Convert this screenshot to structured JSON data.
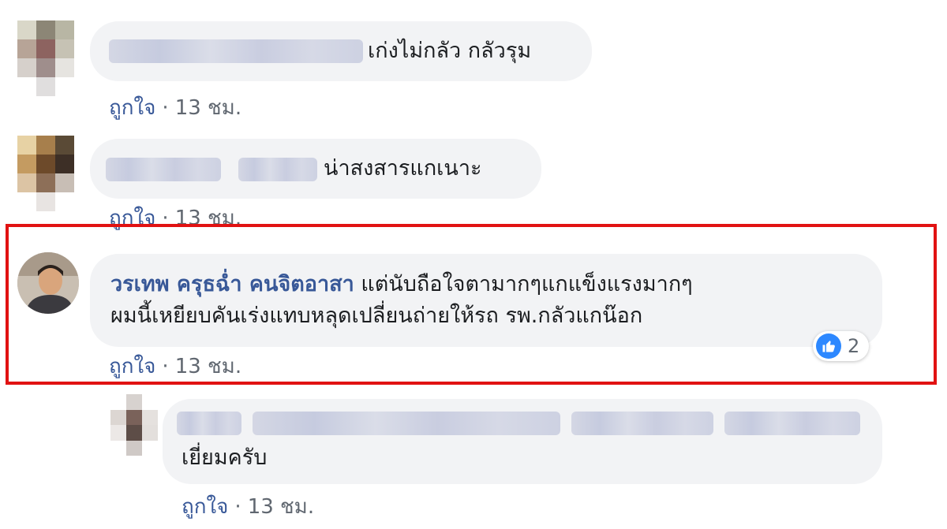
{
  "comments": [
    {
      "text": "เก่งไม่กลัว กลัวรุม",
      "actions": {
        "like": "ถูกใจ",
        "sep": "·",
        "time": "13 ชม."
      }
    },
    {
      "text": "น่าสงสารแกเนาะ",
      "actions": {
        "like": "ถูกใจ",
        "sep": "·",
        "time": "13 ชม."
      }
    },
    {
      "author": "วรเทพ ครุธฉ่ำ คนจิตอาสา",
      "text_line1": "แต่นับถือใจตามากๆแกแข็งแรงมากๆ",
      "text_line2": "ผมนี้เหยียบคันเร่งแทบหลุดเปลี่ยนถ่ายให้รถ รพ.กลัวแกน๊อก",
      "actions": {
        "like": "ถูกใจ",
        "sep": "·",
        "time": "13 ชม."
      },
      "reactions": {
        "icon": "thumbs-up-icon",
        "count": "2"
      }
    },
    {
      "text": "เยี่ยมครับ",
      "actions": {
        "like": "ถูกใจ",
        "sep": "·",
        "time": "13 ชม."
      }
    }
  ],
  "colors": {
    "bubble": "#f2f3f5",
    "author": "#385898",
    "highlight": "#e11212",
    "like_reaction": "#2d88ff",
    "meta": "#606770"
  }
}
